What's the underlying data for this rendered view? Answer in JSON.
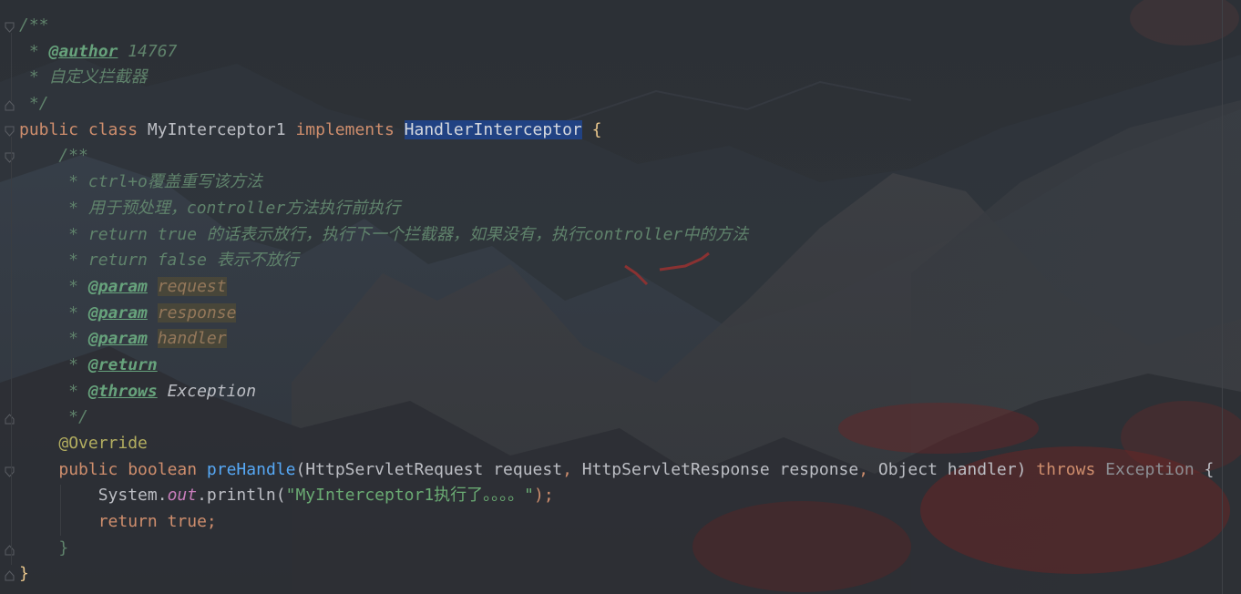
{
  "editor": {
    "language": "java",
    "colors": {
      "background": "#2c3036",
      "keyword": "#cf8e6d",
      "comment": "#5f826b",
      "javadoc_tag": "#67a37c",
      "annotation": "#b3ae60",
      "method": "#56a8f5",
      "string": "#6aab73",
      "static_field": "#c77dbb",
      "selection": "#214283"
    },
    "lines": [
      {
        "tokens": [
          {
            "t": "/**",
            "c": "cm"
          }
        ]
      },
      {
        "tokens": [
          {
            "t": " * ",
            "c": "cm"
          },
          {
            "t": "@author",
            "c": "tag"
          },
          {
            "t": " 14767",
            "c": "cm"
          }
        ]
      },
      {
        "tokens": [
          {
            "t": " * 自定义拦截器",
            "c": "cm"
          }
        ]
      },
      {
        "tokens": [
          {
            "t": " */",
            "c": "cm"
          }
        ]
      },
      {
        "tokens": [
          {
            "t": "public ",
            "c": "kw"
          },
          {
            "t": "class ",
            "c": "kw"
          },
          {
            "t": "MyInterceptor1 ",
            "c": ""
          },
          {
            "t": "implements ",
            "c": "kw"
          },
          {
            "t": "HandlerInterceptor",
            "c": "sel"
          },
          {
            "t": " ",
            "c": ""
          },
          {
            "t": "{",
            "c": "brace"
          }
        ]
      },
      {
        "tokens": [
          {
            "t": "    /**",
            "c": "cm"
          }
        ]
      },
      {
        "tokens": [
          {
            "t": "     * ctrl+o覆盖重写该方法",
            "c": "cm"
          }
        ]
      },
      {
        "tokens": [
          {
            "t": "     * 用于预处理，controller方法执行前执行",
            "c": "cm"
          }
        ]
      },
      {
        "tokens": [
          {
            "t": "     * return true 的话表示放行，执行下一个拦截器，如果没有，执行controller中的方法",
            "c": "cm"
          }
        ]
      },
      {
        "tokens": [
          {
            "t": "     * return ",
            "c": "cm"
          },
          {
            "t": "false",
            "c": "cm"
          },
          {
            "t": " 表示不放行",
            "c": "cm"
          }
        ]
      },
      {
        "tokens": [
          {
            "t": "     * ",
            "c": "cm"
          },
          {
            "t": "@param",
            "c": "tag"
          },
          {
            "t": " ",
            "c": "cm"
          },
          {
            "t": "request",
            "c": "param-ref"
          }
        ]
      },
      {
        "tokens": [
          {
            "t": "     * ",
            "c": "cm"
          },
          {
            "t": "@param",
            "c": "tag"
          },
          {
            "t": " ",
            "c": "cm"
          },
          {
            "t": "response",
            "c": "param-ref"
          }
        ]
      },
      {
        "tokens": [
          {
            "t": "     * ",
            "c": "cm"
          },
          {
            "t": "@param",
            "c": "tag"
          },
          {
            "t": " ",
            "c": "cm"
          },
          {
            "t": "handler",
            "c": "param-ref"
          }
        ]
      },
      {
        "tokens": [
          {
            "t": "     * ",
            "c": "cm"
          },
          {
            "t": "@return",
            "c": "tag"
          }
        ]
      },
      {
        "tokens": [
          {
            "t": "     * ",
            "c": "cm"
          },
          {
            "t": "@throws",
            "c": "tag"
          },
          {
            "t": " ",
            "c": "cm"
          },
          {
            "t": "Exception",
            "c": "exc"
          }
        ]
      },
      {
        "tokens": [
          {
            "t": "     */",
            "c": "cm"
          }
        ]
      },
      {
        "tokens": [
          {
            "t": "    ",
            "c": ""
          },
          {
            "t": "@Override",
            "c": "ann"
          }
        ]
      },
      {
        "tokens": [
          {
            "t": "    ",
            "c": ""
          },
          {
            "t": "public ",
            "c": "kw"
          },
          {
            "t": "boolean ",
            "c": "kw"
          },
          {
            "t": "preHandle",
            "c": "fn"
          },
          {
            "t": "(HttpServletRequest request",
            "c": ""
          },
          {
            "t": ", ",
            "c": "kw"
          },
          {
            "t": "HttpServletResponse response",
            "c": ""
          },
          {
            "t": ", ",
            "c": "kw"
          },
          {
            "t": "Object handler) ",
            "c": ""
          },
          {
            "t": "throws ",
            "c": "kw"
          },
          {
            "t": "Exception ",
            "c": "dim"
          },
          {
            "t": "{",
            "c": ""
          }
        ]
      },
      {
        "tokens": [
          {
            "t": "        System.",
            "c": ""
          },
          {
            "t": "out",
            "c": "field"
          },
          {
            "t": ".println(",
            "c": ""
          },
          {
            "t": "\"MyInterceptor1执行了。。。。\"",
            "c": "str"
          },
          {
            "t": ");",
            "c": "kw"
          }
        ]
      },
      {
        "tokens": [
          {
            "t": "        ",
            "c": ""
          },
          {
            "t": "return ",
            "c": "kw"
          },
          {
            "t": "true",
            "c": "kw"
          },
          {
            "t": ";",
            "c": "kw"
          }
        ]
      },
      {
        "tokens": [
          {
            "t": "    }",
            "c": "cm-plain"
          }
        ]
      },
      {
        "tokens": [
          {
            "t": "}",
            "c": "brace"
          }
        ]
      }
    ]
  }
}
